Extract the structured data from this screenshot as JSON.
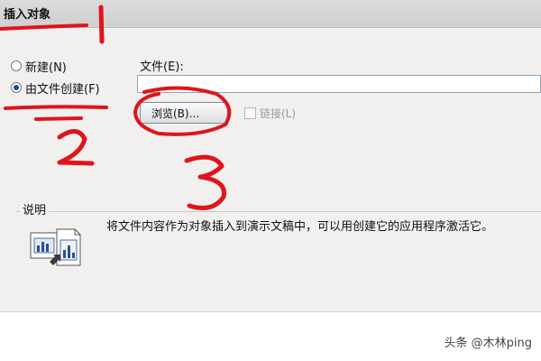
{
  "dialog": {
    "title": "插入对象",
    "options": [
      {
        "label": "新建(N)",
        "checked": false
      },
      {
        "label": "由文件创建(F)",
        "checked": true
      }
    ],
    "file_label": "文件(E):",
    "file_value": "",
    "browse_label": "浏览(B)...",
    "link_label": "链接(L)",
    "description_title": "说明",
    "description_text": "将文件内容作为对象插入到演示文稿中，可以用创建它的应用程序激活它。"
  },
  "annotations": {
    "numbers": [
      "1",
      "2",
      "3"
    ],
    "color": "#e0141b"
  },
  "watermark": "头条 @木林ping"
}
